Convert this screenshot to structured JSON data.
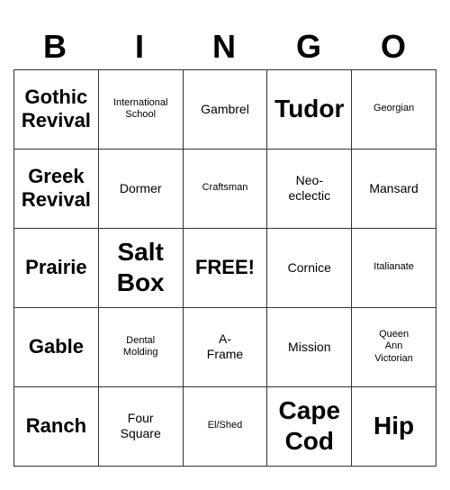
{
  "header": {
    "letters": [
      "B",
      "I",
      "N",
      "G",
      "O"
    ]
  },
  "cells": [
    {
      "text": "Gothic\nRevival",
      "size": "large"
    },
    {
      "text": "International\nSchool",
      "size": "small"
    },
    {
      "text": "Gambrel",
      "size": "medium"
    },
    {
      "text": "Tudor",
      "size": "xlarge"
    },
    {
      "text": "Georgian",
      "size": "small"
    },
    {
      "text": "Greek\nRevival",
      "size": "large"
    },
    {
      "text": "Dormer",
      "size": "medium"
    },
    {
      "text": "Craftsman",
      "size": "small"
    },
    {
      "text": "Neo-\neclectic",
      "size": "medium"
    },
    {
      "text": "Mansard",
      "size": "medium"
    },
    {
      "text": "Prairie",
      "size": "large"
    },
    {
      "text": "Salt\nBox",
      "size": "xlarge"
    },
    {
      "text": "FREE!",
      "size": "large"
    },
    {
      "text": "Cornice",
      "size": "medium"
    },
    {
      "text": "Italianate",
      "size": "small"
    },
    {
      "text": "Gable",
      "size": "large"
    },
    {
      "text": "Dental\nMolding",
      "size": "small"
    },
    {
      "text": "A-\nFrame",
      "size": "medium"
    },
    {
      "text": "Mission",
      "size": "medium"
    },
    {
      "text": "Queen\nAnn\nVictorian",
      "size": "small"
    },
    {
      "text": "Ranch",
      "size": "large"
    },
    {
      "text": "Four\nSquare",
      "size": "medium"
    },
    {
      "text": "El/Shed",
      "size": "small"
    },
    {
      "text": "Cape\nCod",
      "size": "xlarge"
    },
    {
      "text": "Hip",
      "size": "xlarge"
    }
  ]
}
